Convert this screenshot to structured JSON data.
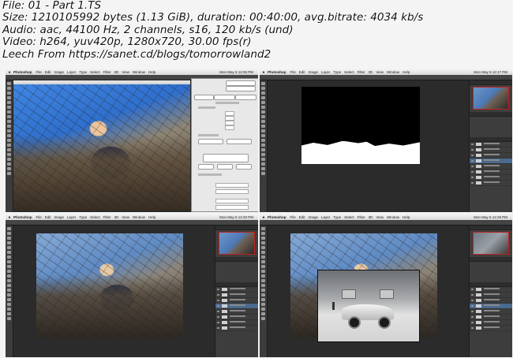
{
  "video_info": {
    "file": "File: 01 - Part 1.TS",
    "size": "Size: 1210105992 bytes (1.13 GiB), duration: 00:40:00, avg.bitrate: 4034 kb/s",
    "audio": "Audio: aac, 44100 Hz, 2 channels, s16, 120 kb/s (und)",
    "video": "Video: h264, yuv420p, 1280x720, 30.00 fps(r)",
    "leech": "Leech From https://sanet.cd/blogs/tomorrowland2"
  },
  "frames": [
    {
      "app": "Photoshop",
      "menu": [
        "File",
        "Edit",
        "Image",
        "Layer",
        "Type",
        "Select",
        "Filter",
        "3D",
        "View",
        "Window",
        "Help"
      ],
      "clock": "Mon May 6  12:06 PM"
    },
    {
      "app": "Photoshop",
      "menu": [
        "File",
        "Edit",
        "Image",
        "Layer",
        "Type",
        "Select",
        "Filter",
        "3D",
        "View",
        "Window",
        "Help"
      ],
      "clock": "Mon May 6  12:17 PM"
    },
    {
      "app": "Photoshop",
      "menu": [
        "File",
        "Edit",
        "Image",
        "Layer",
        "Type",
        "Select",
        "Filter",
        "3D",
        "View",
        "Window",
        "Help"
      ],
      "clock": "Mon May 6  12:20 PM"
    },
    {
      "app": "Photoshop",
      "menu": [
        "File",
        "Edit",
        "Image",
        "Layer",
        "Type",
        "Select",
        "Filter",
        "3D",
        "View",
        "Window",
        "Help"
      ],
      "clock": "Mon May 6  12:29 PM"
    }
  ],
  "colors": {
    "accent_red": "#c02020",
    "ui_dark": "#2b2b2b"
  }
}
